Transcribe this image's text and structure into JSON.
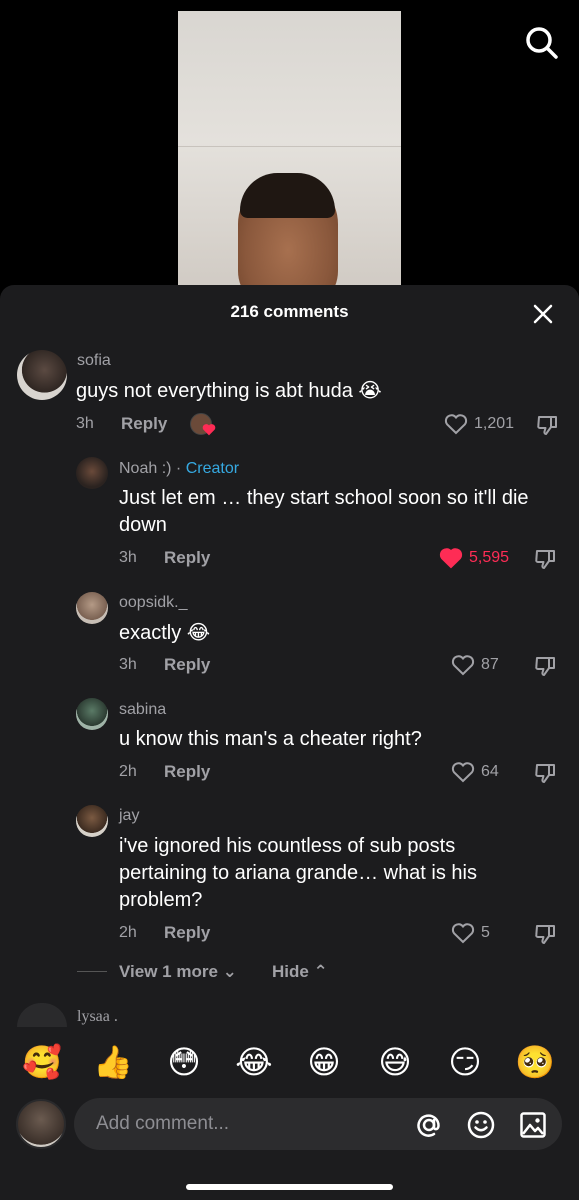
{
  "header": {
    "comment_count_label": "216 comments"
  },
  "comments": [
    {
      "username": "sofia",
      "text": "guys not everything is abt huda 😭",
      "time": "3h",
      "reply_label": "Reply",
      "likes": "1,201",
      "liked": false
    },
    {
      "username": "Noah :)",
      "creator_label": "Creator",
      "separator": " · ",
      "text": "Just let em … they start school soon so it'll die down",
      "time": "3h",
      "reply_label": "Reply",
      "likes": "5,595",
      "liked": true
    },
    {
      "username": "oopsidk._",
      "text": "exactly 😂",
      "time": "3h",
      "reply_label": "Reply",
      "likes": "87",
      "liked": false
    },
    {
      "username": "sabina",
      "text": "u know this man's a cheater right?",
      "time": "2h",
      "reply_label": "Reply",
      "likes": "64",
      "liked": false
    },
    {
      "username": "jay",
      "text": "i've ignored his countless of sub posts pertaining to ariana grande… what is his problem?",
      "time": "2h",
      "reply_label": "Reply",
      "likes": "5",
      "liked": false
    },
    {
      "username": "lysaa ."
    }
  ],
  "thread_controls": {
    "view_more_label": "View 1 more ⌄",
    "hide_label": "Hide ⌃"
  },
  "emoji_bar": [
    "🥰",
    "👍",
    "😳",
    "😂",
    "😁",
    "😅",
    "😏",
    "🥺"
  ],
  "composer": {
    "placeholder": "Add comment..."
  },
  "colors": {
    "accent_red": "#fe2c55",
    "creator_blue": "#36a9e1",
    "sheet_bg": "#1c1c1e"
  }
}
